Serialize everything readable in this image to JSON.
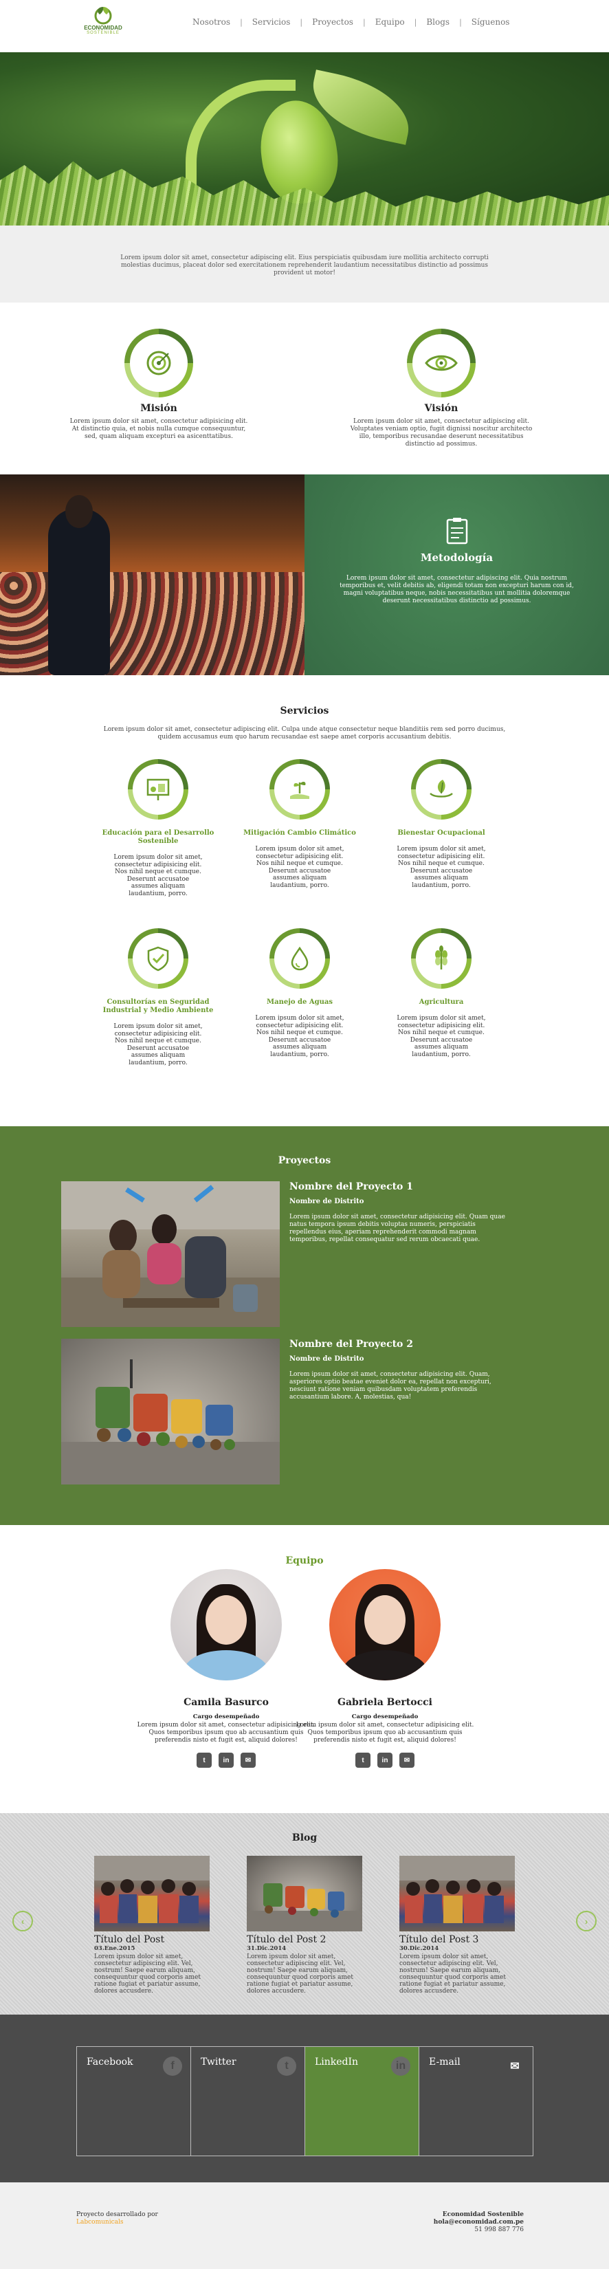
{
  "brand": {
    "name": "ECONOMIDAD",
    "sub": "SOSTENIBLE"
  },
  "nav": {
    "items": [
      "Nosotros",
      "Servicios",
      "Proyectos",
      "Equipo",
      "Blogs",
      "Síguenos"
    ]
  },
  "intro": {
    "text": "Lorem ipsum dolor sit amet, consectetur adipiscing elit. Eius perspiciatis quibusdam iure mollitia architecto corrupti molestias ducimus, placeat dolor sed exercitationem reprehenderit laudantium necessitatibus distinctio ad possimus provident ut motor!"
  },
  "mission": {
    "title": "Misión",
    "text": "Lorem ipsum dolor sit amet, consectetur adipisicing elit. At distinctio quia, et nobis nulla cumque consequuntur, sed, quam aliquam excepturi ea asicenttatibus."
  },
  "vision": {
    "title": "Visión",
    "text": "Lorem ipsum dolor sit amet, consectetur adipiscing elit. Voluptates veniam optio, fugit dignissi noscitur architecto illo, temporibus recusandae deserunt necessitatibus distinctio ad possimus."
  },
  "methodology": {
    "title": "Metodología",
    "text": "Lorem ipsum dolor sit amet, consectetur adipiscing elit. Quia nostrum temporibus et, velit debitis ab, eligendi totam non excepturi harum con id, magni voluptatibus neque, nobis necessitatibus unt mollitia doloremque deserunt necessitatibus distinctio ad possimus."
  },
  "services": {
    "title": "Servicios",
    "intro": "Lorem ipsum dolor sit amet, consectetur adipiscing elit. Culpa unde atque consectetur neque blanditiis rem sed porro ducimus, quidem accusamus eum quo harum recusandae est saepe amet corporis accusantium debitis.",
    "items": [
      {
        "name": "Educación para el Desarrollo Sostenible",
        "text": "Lorem ipsum dolor sit amet, consectetur adipisicing elit. Nos nihil neque et cumque. Deserunt accusatoe assumes aliquam laudantium, porro.",
        "icon": "presentation-icon"
      },
      {
        "name": "Mitigación Cambio Climático",
        "text": "Lorem ipsum dolor sit amet, consectetur adipisicing elit. Nos nihil neque et cumque. Deserunt accusatoe assumes aliquam laudantium, porro.",
        "icon": "hand-plant-icon"
      },
      {
        "name": "Bienestar Ocupacional",
        "text": "Lorem ipsum dolor sit amet, consectetur adipisicing elit. Nos nihil neque et cumque. Deserunt accusatoe assumes aliquam laudantium, porro.",
        "icon": "hands-leaf-icon"
      },
      {
        "name": "Consultorías en Seguridad Industrial y Medio Ambiente",
        "text": "Lorem ipsum dolor sit amet, consectetur adipisicing elit. Nos nihil neque et cumque. Deserunt accusatoe assumes aliquam laudantium, porro.",
        "icon": "shield-check-icon"
      },
      {
        "name": "Manejo de Aguas",
        "text": "Lorem ipsum dolor sit amet, consectetur adipisicing elit. Nos nihil neque et cumque. Deserunt accusatoe assumes aliquam laudantium, porro.",
        "icon": "water-drop-icon"
      },
      {
        "name": "Agricultura",
        "text": "Lorem ipsum dolor sit amet, consectetur adipisicing elit. Nos nihil neque et cumque. Deserunt accusatoe assumes aliquam laudantium, porro.",
        "icon": "wheat-icon"
      }
    ]
  },
  "projects": {
    "title": "Proyectos",
    "items": [
      {
        "name": "Nombre del Proyecto 1",
        "district": "Nombre de Distrito",
        "text": "Lorem ipsum dolor sit amet, consectetur adipisicing elit. Quam quae natus tempora ipsum debitis voluptas numeris, perspiciatis repellendus eius, aperiam reprehenderit commodi magnam temporibus, repellat consequatur sed rerum obcaecati quae."
      },
      {
        "name": "Nombre del Proyecto 2",
        "district": "Nombre de Distrito",
        "text": "Lorem ipsum dolor sit amet, consectetur adipisicing elit. Quam, asperiores optio beatae eveniet dolor ea, repellat non excepturi, nesciunt ratione veniam quibusdam voluptatem preferendis accusantium labore. A, molestias, qua!"
      }
    ]
  },
  "team": {
    "title": "Equipo",
    "members": [
      {
        "name": "Camila Basurco",
        "role": "Cargo desempeñado",
        "text": "Lorem ipsum dolor sit amet, consectetur adipisicing elit. Quos temporibus ipsum quo ab accusantium quis preferendis nisto et fugit est, aliquid dolores!"
      },
      {
        "name": "Gabriela Bertocci",
        "role": "Cargo desempeñado",
        "text": "Lorem ipsum dolor sit amet, consectetur adipisicing elit. Quos temporibus ipsum quo ab accusantium quis preferendis nisto et fugit est, aliquid dolores!"
      }
    ],
    "social_labels": [
      "t",
      "in",
      "✉"
    ]
  },
  "blog": {
    "title": "Blog",
    "posts": [
      {
        "title": "Título del Post",
        "date": "03.Ene.2015",
        "text": "Lorem ipsum dolor sit amet, consectetur adipiscing elit. Vel, nostrum! Saepe earum aliquam, consequuntur quod corporis amet ratione fugiat et pariatur assume, dolores accusdere."
      },
      {
        "title": "Título del Post 2",
        "date": "31.Dic.2014",
        "text": "Lorem ipsum dolor sit amet, consectetur adipiscing elit. Vel, nostrum! Saepe earum aliquam, consequuntur quod corporis amet ratione fugiat et pariatur assume, dolores accusdere."
      },
      {
        "title": "Título del Post 3",
        "date": "30.Dic.2014",
        "text": "Lorem ipsum dolor sit amet, consectetur adipiscing elit. Vel, nostrum! Saepe earum aliquam, consequuntur quod corporis amet ratione fugiat et pariatur assume, dolores accusdere."
      }
    ],
    "prev": "‹",
    "next": "›"
  },
  "social": {
    "tiles": [
      {
        "name": "Facebook",
        "glyph": "f"
      },
      {
        "name": "Twitter",
        "glyph": "t"
      },
      {
        "name": "LinkedIn",
        "glyph": "in"
      },
      {
        "name": "E-mail",
        "glyph": "✉"
      }
    ],
    "active_index": 2,
    "active_color": "#5e8a3a"
  },
  "footer": {
    "credit_prefix": "Proyecto desarrollado por",
    "credit_link": "Labcomunicals",
    "org": "Economidad Sostenible",
    "email": "hola@economidad.com.pe",
    "phone": "51 998 887 776"
  },
  "colors": {
    "accent": "#6b9a2c",
    "projects_bg": "#5b7f39",
    "methodology_bg": "#3f7a4e",
    "social_bg": "#4b4b4b"
  }
}
